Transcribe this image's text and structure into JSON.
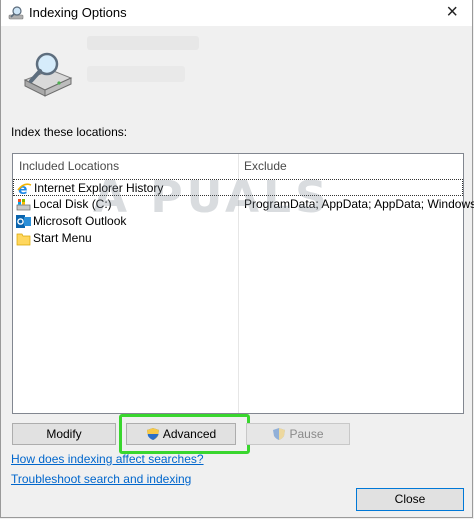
{
  "window": {
    "title": "Indexing Options"
  },
  "section_label": "Index these locations:",
  "list": {
    "columns": {
      "included": "Included Locations",
      "exclude": "Exclude"
    },
    "rows": [
      {
        "name": "Internet Explorer History",
        "exclude": "",
        "icon": "ie-icon",
        "selected": true
      },
      {
        "name": "Local Disk (C:)",
        "exclude": "ProgramData; AppData; AppData; Windows",
        "icon": "disk-icon"
      },
      {
        "name": "Microsoft Outlook",
        "exclude": "",
        "icon": "outlook-icon"
      },
      {
        "name": "Start Menu",
        "exclude": "",
        "icon": "folder-icon"
      }
    ]
  },
  "watermark": "A PUALS",
  "buttons": {
    "modify": "Modify",
    "advanced": "Advanced",
    "pause": "Pause",
    "close": "Close"
  },
  "links": {
    "how_indexing": "How does indexing affect searches?",
    "troubleshoot": "Troubleshoot search and indexing"
  },
  "colors": {
    "link": "#0066cc",
    "highlight": "#39d62e",
    "focus_border": "#0078d7"
  }
}
